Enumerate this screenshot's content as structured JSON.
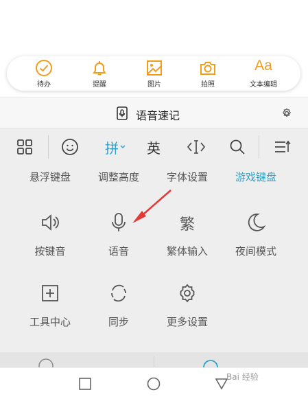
{
  "quickbar": {
    "items": [
      {
        "label": "待办",
        "icon": "check-circle-icon"
      },
      {
        "label": "提醒",
        "icon": "bell-icon"
      },
      {
        "label": "图片",
        "icon": "image-icon"
      },
      {
        "label": "拍照",
        "icon": "camera-icon"
      },
      {
        "label": "文本编辑",
        "icon_text": "Aa"
      }
    ],
    "accent": "#f39c19"
  },
  "voicebar": {
    "title": "语音速记"
  },
  "keyboard": {
    "toprow": {
      "pinyin": "拼",
      "english": "英"
    },
    "tabs": [
      {
        "label": "悬浮键盘"
      },
      {
        "label": "调整高度"
      },
      {
        "label": "字体设置"
      },
      {
        "label": "游戏键盘",
        "active": true
      }
    ],
    "grid": [
      {
        "label": "按键音",
        "icon": "speaker-icon"
      },
      {
        "label": "语音",
        "icon": "microphone-icon"
      },
      {
        "label": "繁体输入",
        "icon_text": "繁"
      },
      {
        "label": "夜间模式",
        "icon": "moon-icon"
      },
      {
        "label": "工具中心",
        "icon": "plus-square-icon"
      },
      {
        "label": "同步",
        "icon": "sync-icon"
      },
      {
        "label": "更多设置",
        "icon": "gear-icon"
      }
    ],
    "active_color": "#2fa3c9"
  },
  "watermark": "Bai 经验"
}
